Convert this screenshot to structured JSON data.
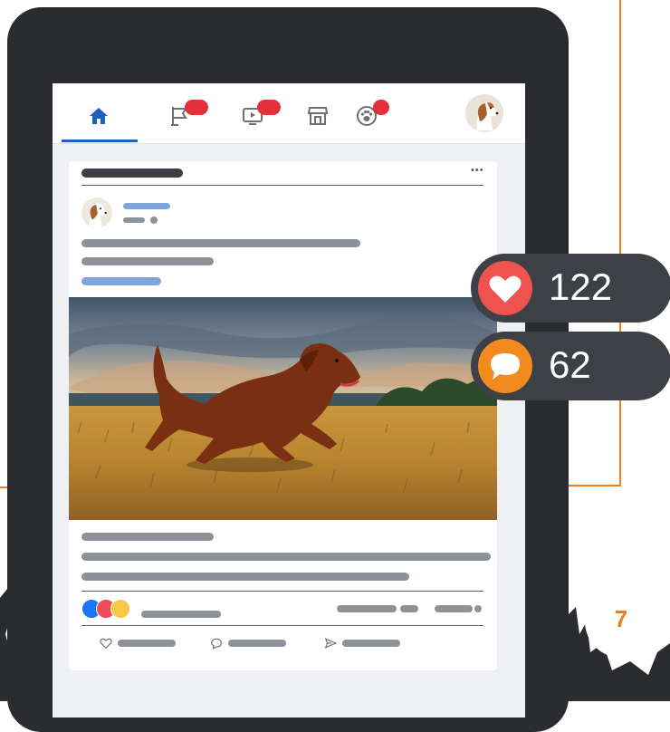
{
  "colors": {
    "accent": "#e8811f",
    "tablet_frame": "#2a2c2f",
    "nav_active": "#1f5fbf",
    "notification": "#e2303d",
    "like_red": "#ef5350",
    "comment_orange": "#f28a1d",
    "pill_dark": "#3d4045"
  },
  "nav": {
    "items": [
      {
        "icon": "home-icon",
        "active": true
      },
      {
        "icon": "flag-icon",
        "has_badge": true
      },
      {
        "icon": "video-icon",
        "has_badge": true
      },
      {
        "icon": "marketplace-icon"
      },
      {
        "icon": "paw-icon",
        "has_badge": true
      }
    ],
    "profile_avatar": "dog-avatar"
  },
  "post": {
    "menu_glyph": "•••",
    "image": "dog-running-in-field",
    "reactions": [
      "like-reaction",
      "love-reaction",
      "wow-reaction"
    ],
    "actions": [
      "heart-icon",
      "comment-icon",
      "share-icon"
    ]
  },
  "stats": {
    "likes": "122",
    "comments": "62"
  },
  "page_number": "7"
}
